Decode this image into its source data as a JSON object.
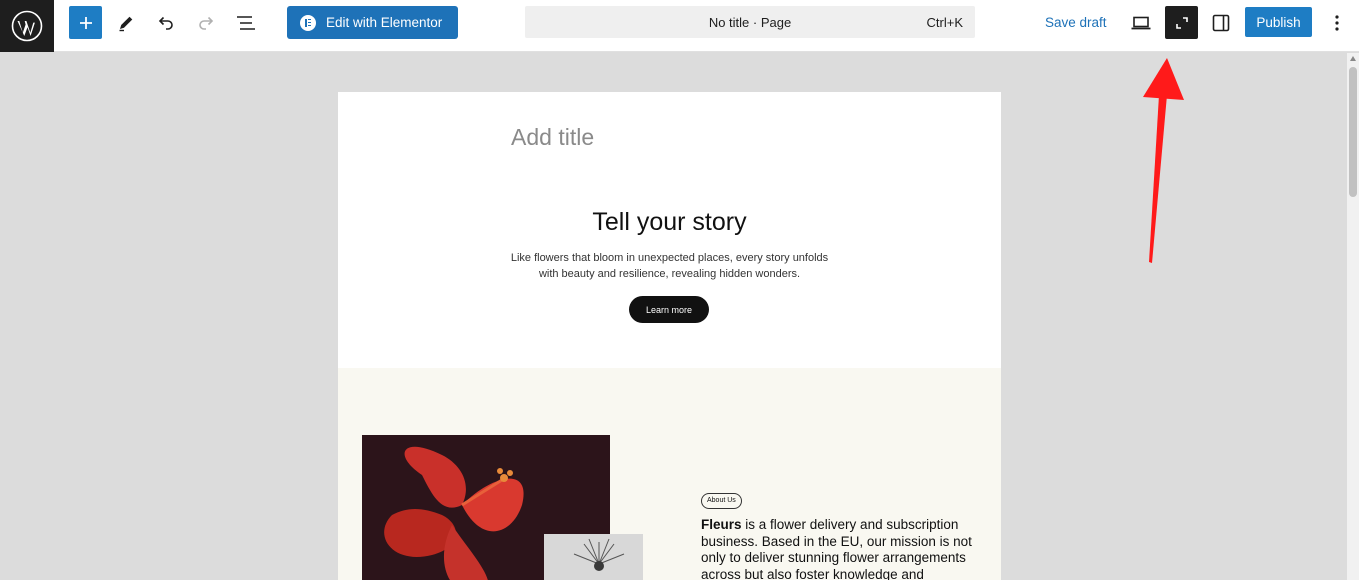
{
  "toolbar": {
    "edit_with_elementor": "Edit with Elementor",
    "document_title": "No title · Page",
    "shortcut": "Ctrl+K",
    "save_draft": "Save draft",
    "publish": "Publish",
    "accent_color": "#1e7dc4"
  },
  "canvas": {
    "title_placeholder": "Add title",
    "story_heading": "Tell your story",
    "story_text_line1": "Like flowers that bloom in unexpected places, every story unfolds",
    "story_text_line2": "with beauty and resilience, revealing hidden wonders.",
    "learn_more": "Learn more",
    "about_badge": "About Us",
    "about_brand": "Fleurs",
    "about_text": " is a flower delivery and subscription business. Based in the EU, our mission is not only to deliver stunning flower arrangements across but also foster knowledge and"
  },
  "annotation": {
    "arrow_color": "#ff1a1a",
    "points_to": "fullscreen-button"
  }
}
